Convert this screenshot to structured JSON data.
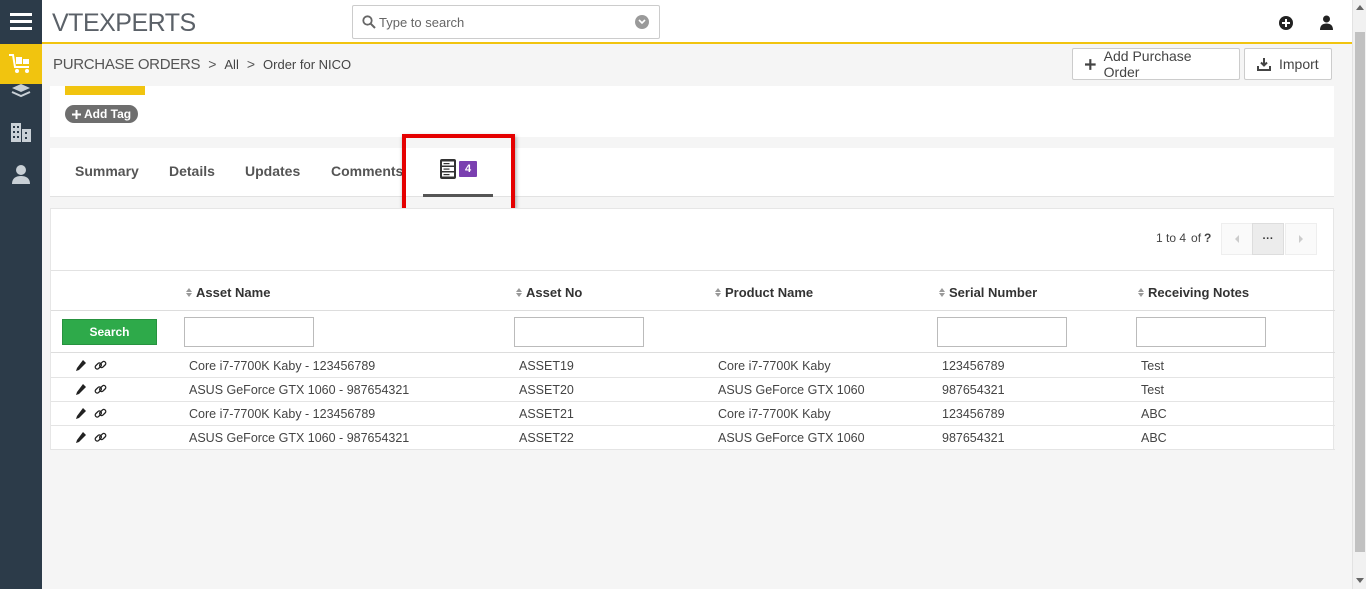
{
  "topbar": {
    "logo": "VTEXPERTS",
    "search_placeholder": "Type to search"
  },
  "breadcrumb": {
    "module": "PURCHASE ORDERS",
    "separator": ">",
    "filter": "All",
    "record": "Order for NICO"
  },
  "actions": {
    "add_label": "Add Purchase Order",
    "import_label": "Import"
  },
  "tags": {
    "add_tag_label": "Add Tag"
  },
  "tabs": {
    "summary": "Summary",
    "details": "Details",
    "updates": "Updates",
    "comments": "Comments",
    "assets_count": "4"
  },
  "pager": {
    "range": "1 to 4",
    "of_label": "of",
    "total": "?",
    "more": "···"
  },
  "table": {
    "headers": [
      "Asset Name",
      "Asset No",
      "Product Name",
      "Serial Number",
      "Receiving Notes"
    ],
    "search_label": "Search",
    "rows": [
      [
        "Core i7-7700K Kaby - 123456789",
        "ASSET19",
        "Core i7-7700K Kaby",
        "123456789",
        "Test"
      ],
      [
        "ASUS GeForce GTX 1060 - 987654321",
        "ASSET20",
        "ASUS GeForce GTX 1060",
        "987654321",
        "Test"
      ],
      [
        "Core i7-7700K Kaby - 123456789",
        "ASSET21",
        "Core i7-7700K Kaby",
        "123456789",
        "ABC"
      ],
      [
        "ASUS GeForce GTX 1060 - 987654321",
        "ASSET22",
        "ASUS GeForce GTX 1060",
        "987654321",
        "ABC"
      ]
    ]
  },
  "colors": {
    "accent": "#f1c40f",
    "sidebar": "#2c3b49",
    "badge": "#7a3fb0",
    "search_button": "#2eaa4a",
    "highlight": "#e50000"
  }
}
